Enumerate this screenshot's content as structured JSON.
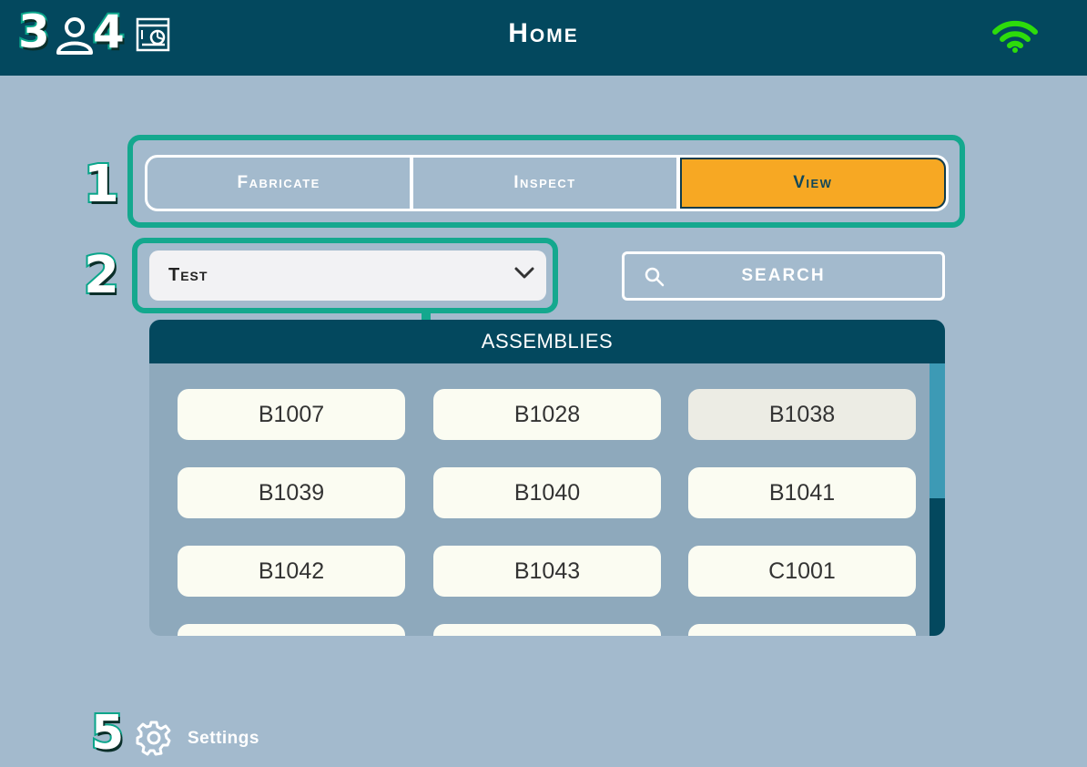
{
  "header": {
    "title": "Home",
    "badges": [
      "3",
      "4"
    ]
  },
  "callouts": [
    "1",
    "2",
    "5"
  ],
  "modes": {
    "tabs": [
      {
        "label": "Fabricate",
        "active": false
      },
      {
        "label": "Inspect",
        "active": false
      },
      {
        "label": "View",
        "active": true
      }
    ]
  },
  "project_select": {
    "value": "Test"
  },
  "search": {
    "label": "SEARCH"
  },
  "assemblies": {
    "title": "ASSEMBLIES",
    "items": [
      "B1007",
      "B1028",
      "B1038",
      "B1039",
      "B1040",
      "B1041",
      "B1042",
      "B1043",
      "C1001"
    ]
  },
  "footer": {
    "settings_label": "Settings"
  },
  "colors": {
    "header_bg": "#03485e",
    "accent": "#f7a823",
    "callout": "#14a88e",
    "wifi": "#2ddc0b"
  },
  "icons": [
    "user-icon",
    "dashboard-icon",
    "wifi-icon",
    "search-icon",
    "chevron-down-icon",
    "gear-icon"
  ]
}
